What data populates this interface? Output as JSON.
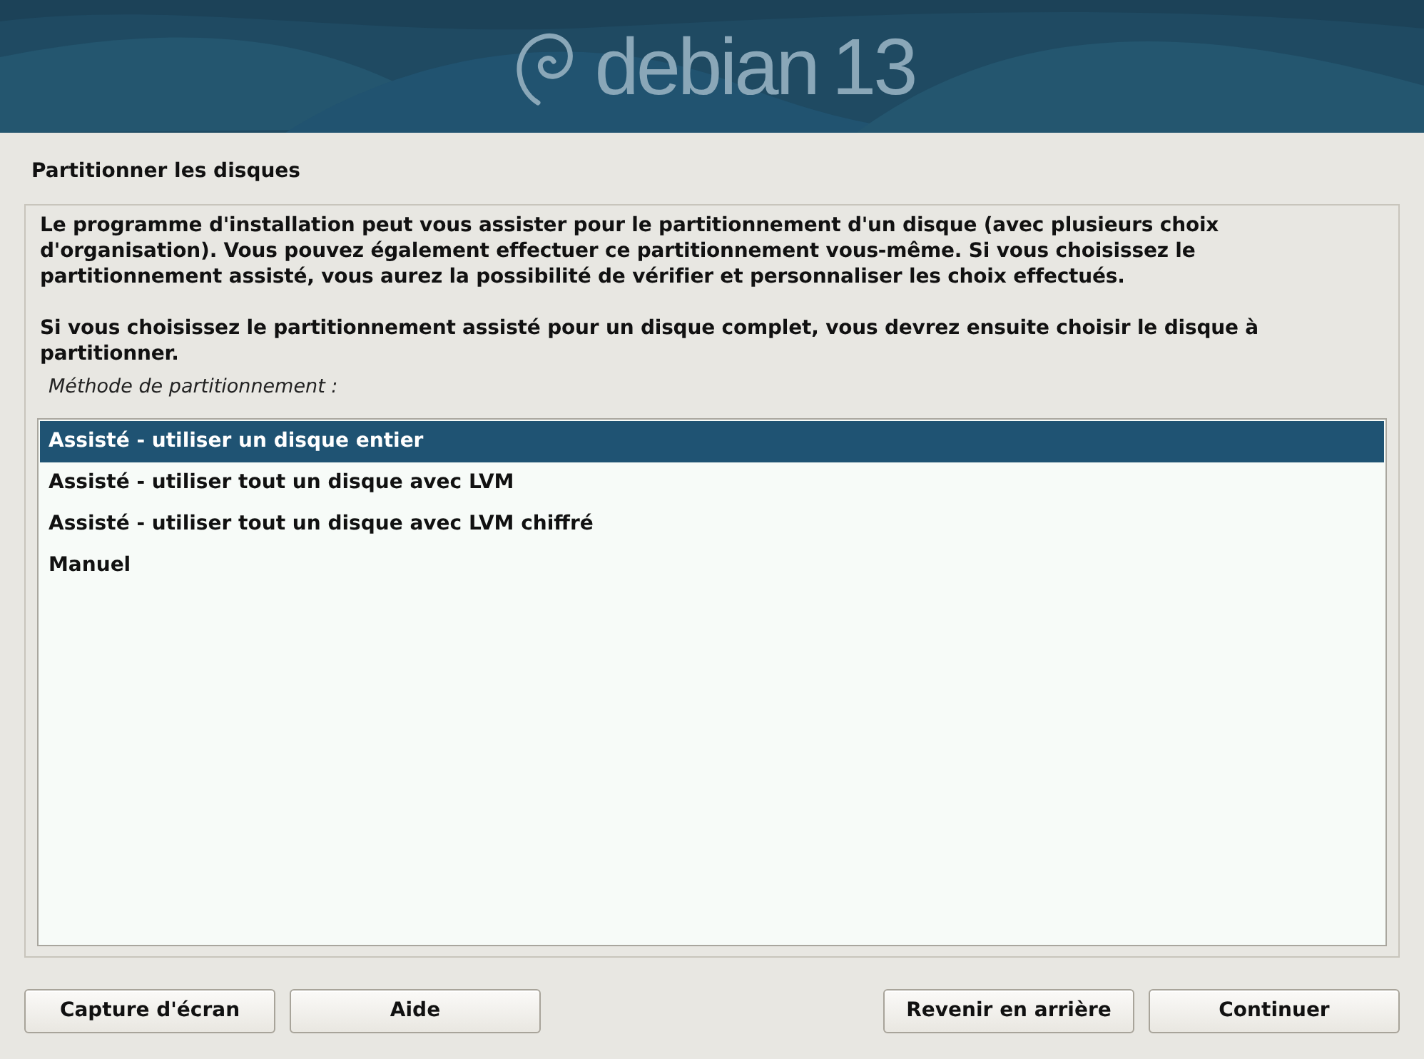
{
  "banner": {
    "logo_text": "debian",
    "version": "13"
  },
  "title": "Partitionner les disques",
  "paragraphs": [
    "Le programme d'installation peut vous assister pour le partitionnement d'un disque (avec plusieurs choix d'organisation). Vous pouvez également effectuer ce partitionnement vous-même. Si vous choisissez le partitionnement assisté, vous aurez la possibilité de vérifier et personnaliser les choix effectués.",
    "Si vous choisissez le partitionnement assisté pour un disque complet, vous devrez ensuite choisir le disque à partitionner."
  ],
  "list_label": "Méthode de partitionnement :",
  "options": [
    {
      "label": "Assisté - utiliser un disque entier",
      "selected": true
    },
    {
      "label": "Assisté - utiliser tout un disque avec LVM",
      "selected": false
    },
    {
      "label": "Assisté - utiliser tout un disque avec LVM chiffré",
      "selected": false
    },
    {
      "label": "Manuel",
      "selected": false
    }
  ],
  "buttons_left": [
    "Capture d'écran",
    "Aide"
  ],
  "buttons_right": [
    "Revenir en arrière",
    "Continuer"
  ]
}
